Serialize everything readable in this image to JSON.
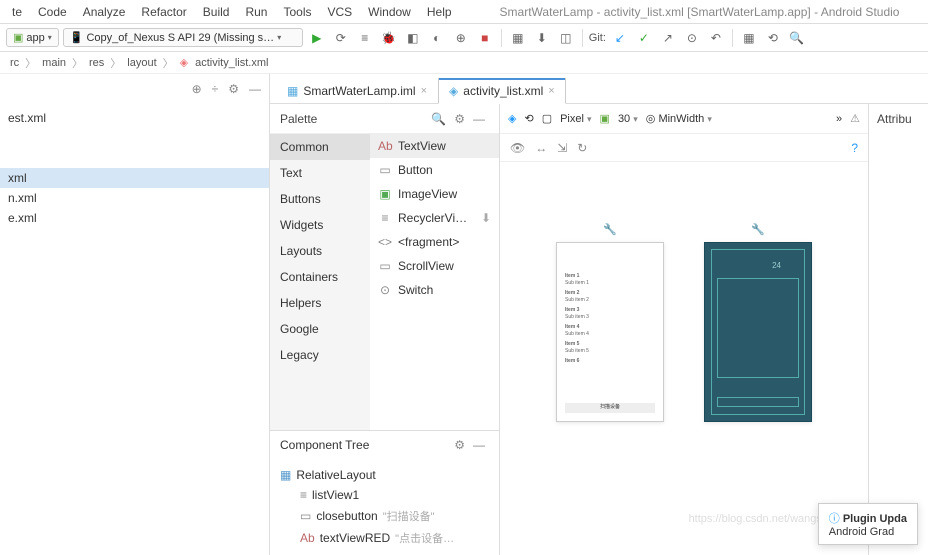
{
  "window": {
    "title": "SmartWaterLamp - activity_list.xml [SmartWaterLamp.app] - Android Studio"
  },
  "menu": {
    "items": [
      "te",
      "Code",
      "Analyze",
      "Refactor",
      "Build",
      "Run",
      "Tools",
      "VCS",
      "Window",
      "Help"
    ]
  },
  "toolbar": {
    "app_config": "app",
    "device": "Copy_of_Nexus S API 29 (Missing s…",
    "git_label": "Git:"
  },
  "breadcrumb": {
    "parts": [
      "rc",
      "main",
      "res",
      "layout",
      "activity_list.xml"
    ]
  },
  "project": {
    "files": [
      "est.xml",
      "",
      "xml",
      "n.xml",
      "e.xml"
    ]
  },
  "editor_tabs": [
    {
      "label": "SmartWaterLamp.iml",
      "active": false
    },
    {
      "label": "activity_list.xml",
      "active": true
    }
  ],
  "palette": {
    "title": "Palette",
    "categories": [
      "Common",
      "Text",
      "Buttons",
      "Widgets",
      "Layouts",
      "Containers",
      "Helpers",
      "Google",
      "Legacy"
    ],
    "selected_category": "Common",
    "widgets": [
      {
        "icon": "Ab",
        "label": "TextView",
        "selected": true
      },
      {
        "icon": "▭",
        "label": "Button"
      },
      {
        "icon": "▣",
        "label": "ImageView"
      },
      {
        "icon": "≡",
        "label": "RecyclerVi…"
      },
      {
        "icon": "<>",
        "label": "<fragment>"
      },
      {
        "icon": "▭",
        "label": "ScrollView"
      },
      {
        "icon": "⊙",
        "label": "Switch"
      }
    ]
  },
  "component_tree": {
    "title": "Component Tree",
    "items": [
      {
        "icon": "▦",
        "label": "RelativeLayout",
        "indent": 0
      },
      {
        "icon": "≡",
        "label": "listView1",
        "indent": 1
      },
      {
        "icon": "▭",
        "label": "closebutton",
        "hint": "\"扫描设备\"",
        "indent": 1
      },
      {
        "icon": "Ab",
        "label": "textViewRED",
        "hint": "\"点击设备…",
        "indent": 1
      }
    ]
  },
  "preview": {
    "device_name": "Pixel",
    "api_level": "30",
    "mode": "MinWidth",
    "list_items": [
      "Item 1",
      "Sub item 1",
      "Item 2",
      "Sub item 2",
      "Item 3",
      "Sub item 3",
      "Item 4",
      "Sub item 4",
      "Item 5",
      "Sub item 5",
      "Item 6"
    ],
    "button_text": "扫描设备",
    "blueprint_label": "24"
  },
  "attributes": {
    "title": "Attribu"
  },
  "notification": {
    "title": "Plugin Upda",
    "subtitle": "Android Grad"
  },
  "watermark": "https://blog.csdn.net/wangsh"
}
